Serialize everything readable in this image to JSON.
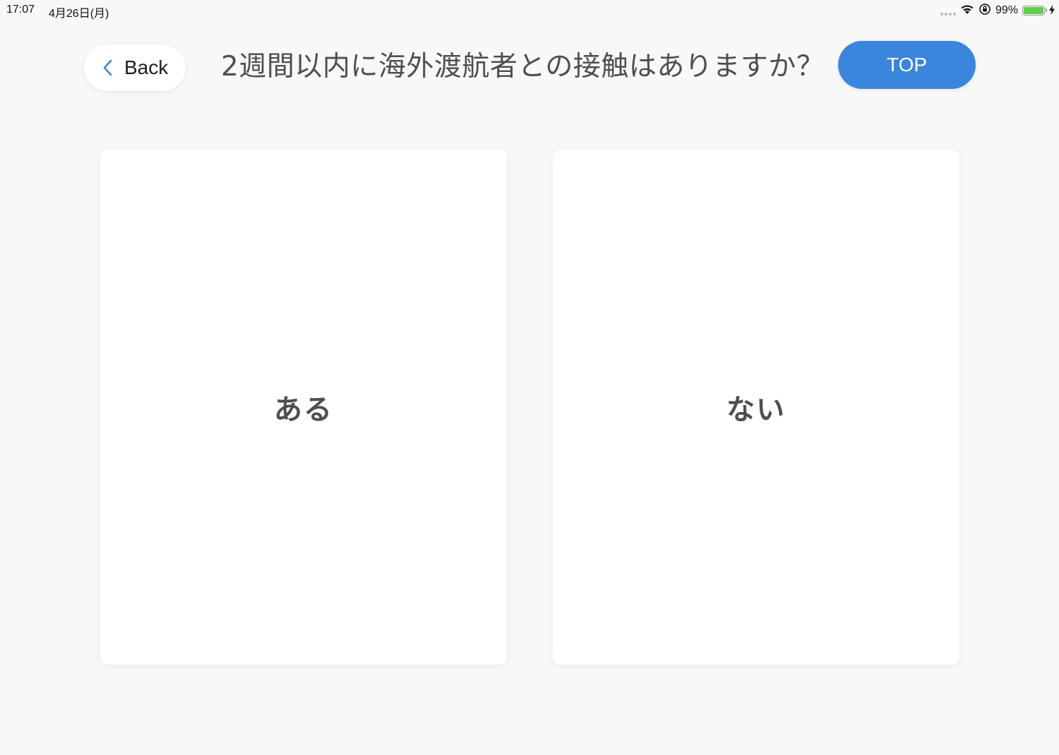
{
  "status_bar": {
    "time": "17:07",
    "date": "4月26日(月)",
    "battery_percent": "99%",
    "battery_level": 0.99,
    "icons": [
      "signal-dots-icon",
      "wifi-icon",
      "orientation-lock-icon",
      "battery-icon",
      "charging-bolt-icon"
    ]
  },
  "header": {
    "back_label": "Back",
    "title": "2週間以内に海外渡航者との接触はありますか？",
    "top_label": "TOP"
  },
  "answers": [
    {
      "label": "ある"
    },
    {
      "label": "ない"
    }
  ],
  "colors": {
    "background": "#f8f8f8",
    "accent": "#3b86dd",
    "back_chevron": "#3b86dd",
    "card": "#ffffff",
    "battery": "#5fcf4a"
  }
}
